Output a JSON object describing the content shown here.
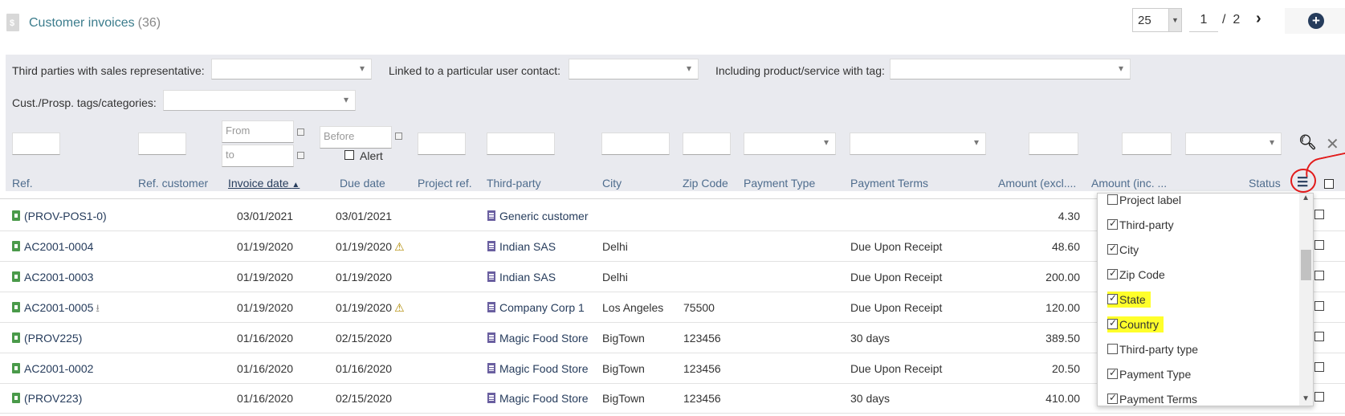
{
  "header": {
    "title": "Customer invoices",
    "count": "(36)",
    "page_size": "25",
    "page_current": "1",
    "page_sep": "/",
    "page_total": "2"
  },
  "filters": {
    "sales_rep_label": "Third parties with sales representative:",
    "user_contact_label": "Linked to a particular user contact:",
    "product_tag_label": "Including product/service with tag:",
    "cust_tags_label": "Cust./Prosp. tags/categories:",
    "from_placeholder": "From",
    "to_placeholder": "to",
    "before_placeholder": "Before",
    "alert_label": "Alert"
  },
  "columns": {
    "ref": "Ref.",
    "ref_customer": "Ref. customer",
    "invoice_date": "Invoice date",
    "due_date": "Due date",
    "project_ref": "Project ref.",
    "third_party": "Third-party",
    "city": "City",
    "zip": "Zip Code",
    "payment_type": "Payment Type",
    "payment_terms": "Payment Terms",
    "amount_excl": "Amount (excl....",
    "amount_inc": "Amount (inc. ...",
    "status": "Status"
  },
  "rows": [
    {
      "ref": "(PROV-POS1-0)",
      "invoice_date": "03/01/2021",
      "due_date": "03/01/2021",
      "third_party": "Generic customer",
      "city": "",
      "zip": "",
      "payment_terms": "",
      "amount": "4.30"
    },
    {
      "ref": "AC2001-0004",
      "invoice_date": "01/19/2020",
      "due_date": "01/19/2020",
      "third_party": "Indian SAS",
      "city": "Delhi",
      "zip": "",
      "payment_terms": "Due Upon Receipt",
      "amount": "48.60"
    },
    {
      "ref": "AC2001-0003",
      "invoice_date": "01/19/2020",
      "due_date": "01/19/2020",
      "third_party": "Indian SAS",
      "city": "Delhi",
      "zip": "",
      "payment_terms": "Due Upon Receipt",
      "amount": "200.00"
    },
    {
      "ref": "AC2001-0005",
      "invoice_date": "01/19/2020",
      "due_date": "01/19/2020",
      "third_party": "Company Corp 1",
      "city": "Los Angeles",
      "zip": "75500",
      "payment_terms": "Due Upon Receipt",
      "amount": "120.00"
    },
    {
      "ref": "(PROV225)",
      "invoice_date": "01/16/2020",
      "due_date": "02/15/2020",
      "third_party": "Magic Food Store",
      "city": "BigTown",
      "zip": "123456",
      "payment_terms": "30 days",
      "amount": "389.50"
    },
    {
      "ref": "AC2001-0002",
      "invoice_date": "01/16/2020",
      "due_date": "01/16/2020",
      "third_party": "Magic Food Store",
      "city": "BigTown",
      "zip": "123456",
      "payment_terms": "Due Upon Receipt",
      "amount": "20.50"
    },
    {
      "ref": "(PROV223)",
      "invoice_date": "01/16/2020",
      "due_date": "02/15/2020",
      "third_party": "Magic Food Store",
      "city": "BigTown",
      "zip": "123456",
      "payment_terms": "30 days",
      "amount": "410.00"
    }
  ],
  "column_menu": [
    {
      "label": "Project label",
      "checked": false
    },
    {
      "label": "Third-party",
      "checked": true
    },
    {
      "label": "City",
      "checked": true
    },
    {
      "label": "Zip Code",
      "checked": true
    },
    {
      "label": "State",
      "checked": true
    },
    {
      "label": "Country",
      "checked": true
    },
    {
      "label": "Third-party type",
      "checked": false
    },
    {
      "label": "Payment Type",
      "checked": true
    },
    {
      "label": "Payment Terms",
      "checked": true
    }
  ],
  "colors": {
    "link": "#263c5c",
    "title": "#3b7c8c",
    "filter_bg": "#e9eaef",
    "highlight": "#ffff2a",
    "annotation": "#e21b1b"
  }
}
